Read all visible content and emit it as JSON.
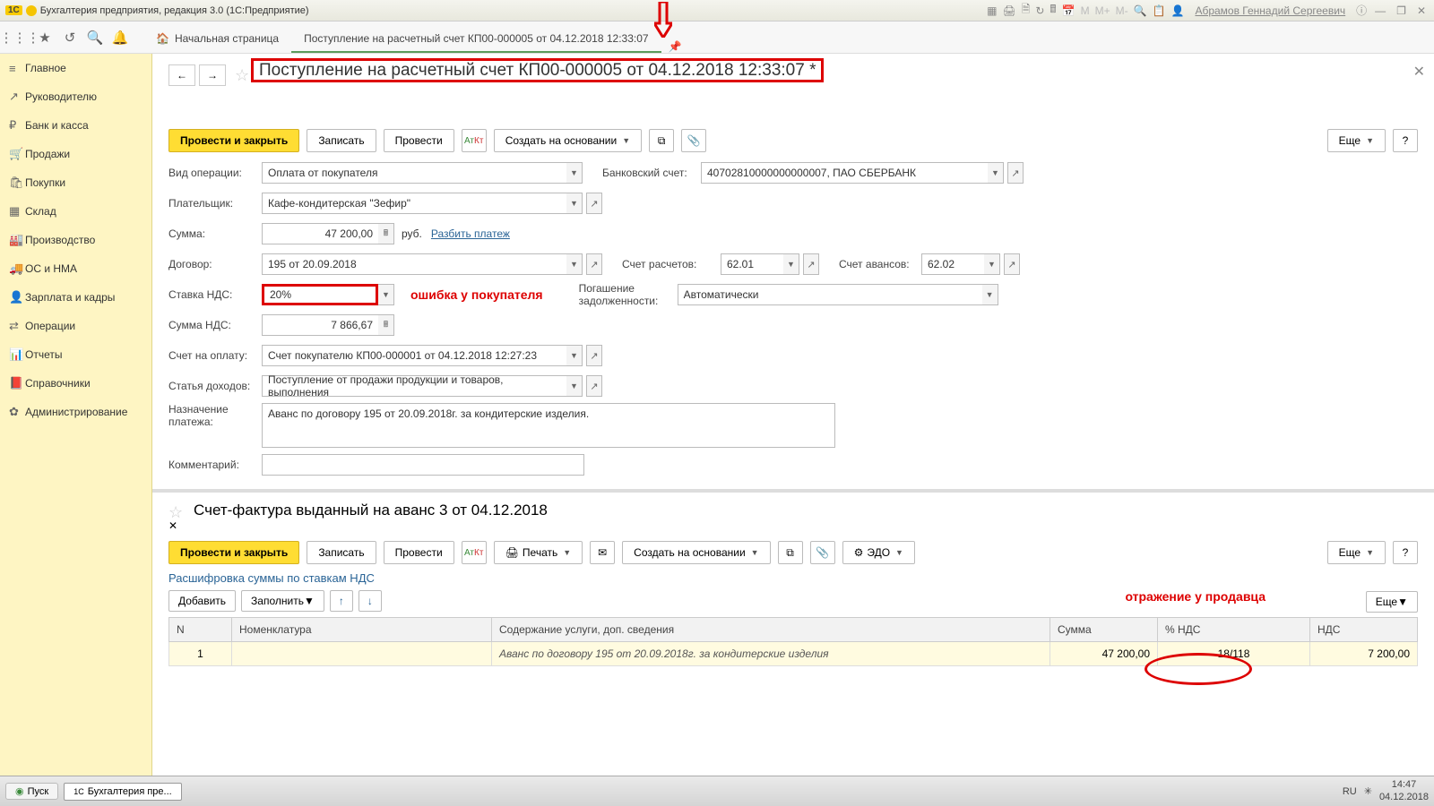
{
  "titlebar": {
    "title": "Бухгалтерия предприятия, редакция 3.0  (1С:Предприятие)",
    "user": "Абрамов Геннадий Сергеевич"
  },
  "toolbar": {
    "home_tab": "Начальная страница",
    "doc_tab": "Поступление на расчетный счет КП00-000005 от 04.12.2018 12:33:07"
  },
  "sidebar": {
    "items": [
      {
        "icon": "≡",
        "label": "Главное"
      },
      {
        "icon": "↗",
        "label": "Руководителю"
      },
      {
        "icon": "₽",
        "label": "Банк и касса"
      },
      {
        "icon": "🛒",
        "label": "Продажи"
      },
      {
        "icon": "🛍",
        "label": "Покупки"
      },
      {
        "icon": "▦",
        "label": "Склад"
      },
      {
        "icon": "🏭",
        "label": "Производство"
      },
      {
        "icon": "🚚",
        "label": "ОС и НМА"
      },
      {
        "icon": "👤",
        "label": "Зарплата и кадры"
      },
      {
        "icon": "⇄",
        "label": "Операции"
      },
      {
        "icon": "📊",
        "label": "Отчеты"
      },
      {
        "icon": "📕",
        "label": "Справочники"
      },
      {
        "icon": "✿",
        "label": "Администрирование"
      }
    ]
  },
  "doc": {
    "title": "Поступление на расчетный счет КП00-000005 от 04.12.2018 12:33:07 *",
    "btn_post_close": "Провести и закрыть",
    "btn_save": "Записать",
    "btn_post": "Провести",
    "btn_create_basis": "Создать на основании",
    "btn_more": "Еще",
    "form": {
      "op_type_lbl": "Вид операции:",
      "op_type_val": "Оплата от покупателя",
      "bank_acc_lbl": "Банковский счет:",
      "bank_acc_val": "40702810000000000007, ПАО СБЕРБАНК",
      "payer_lbl": "Плательщик:",
      "payer_val": "Кафе-кондитерская \"Зефир\"",
      "sum_lbl": "Сумма:",
      "sum_val": "47 200,00",
      "sum_curr": "руб.",
      "split_link": "Разбить платеж",
      "contract_lbl": "Договор:",
      "contract_val": "195 от 20.09.2018",
      "acc_calc_lbl": "Счет расчетов:",
      "acc_calc_val": "62.01",
      "acc_adv_lbl": "Счет авансов:",
      "acc_adv_val": "62.02",
      "vat_rate_lbl": "Ставка НДС:",
      "vat_rate_val": "20%",
      "debt_lbl": "Погашение задолженности:",
      "debt_val": "Автоматически",
      "vat_sum_lbl": "Сумма НДС:",
      "vat_sum_val": "7 866,67",
      "invoice_lbl": "Счет на оплату:",
      "invoice_val": "Счет покупателю КП00-000001 от 04.12.2018 12:27:23",
      "income_lbl": "Статья доходов:",
      "income_val": "Поступление от продажи продукции и товаров, выполнения",
      "purpose_lbl": "Назначение платежа:",
      "purpose_val": "Аванс по договору 195 от 20.09.2018г. за кондитерские изделия.",
      "comment_lbl": "Комментарий:"
    },
    "annotation1": "ошибка у покупателя"
  },
  "doc2": {
    "title": "Счет-фактура выданный на аванс 3 от 04.12.2018",
    "btn_post_close": "Провести и закрыть",
    "btn_save": "Записать",
    "btn_post": "Провести",
    "btn_print": "Печать",
    "btn_create_basis": "Создать на основании",
    "btn_edo": "ЭДО",
    "btn_more": "Еще",
    "table_caption": "Расшифровка суммы по ставкам НДС",
    "btn_add": "Добавить",
    "btn_fill": "Заполнить",
    "columns": {
      "n": "N",
      "nomen": "Номенклатура",
      "desc": "Содержание услуги, доп. сведения",
      "sum": "Сумма",
      "vat_pct": "% НДС",
      "vat": "НДС"
    },
    "row": {
      "n": "1",
      "desc": "Аванс по договору 195 от 20.09.2018г. за кондитерские изделия",
      "sum": "47 200,00",
      "vat_pct": "18/118",
      "vat": "7 200,00"
    },
    "annotation2": "отражение у продавца"
  },
  "taskbar": {
    "start": "Пуск",
    "app": "Бухгалтерия пре...",
    "lang": "RU",
    "time": "14:47",
    "date": "04.12.2018"
  }
}
